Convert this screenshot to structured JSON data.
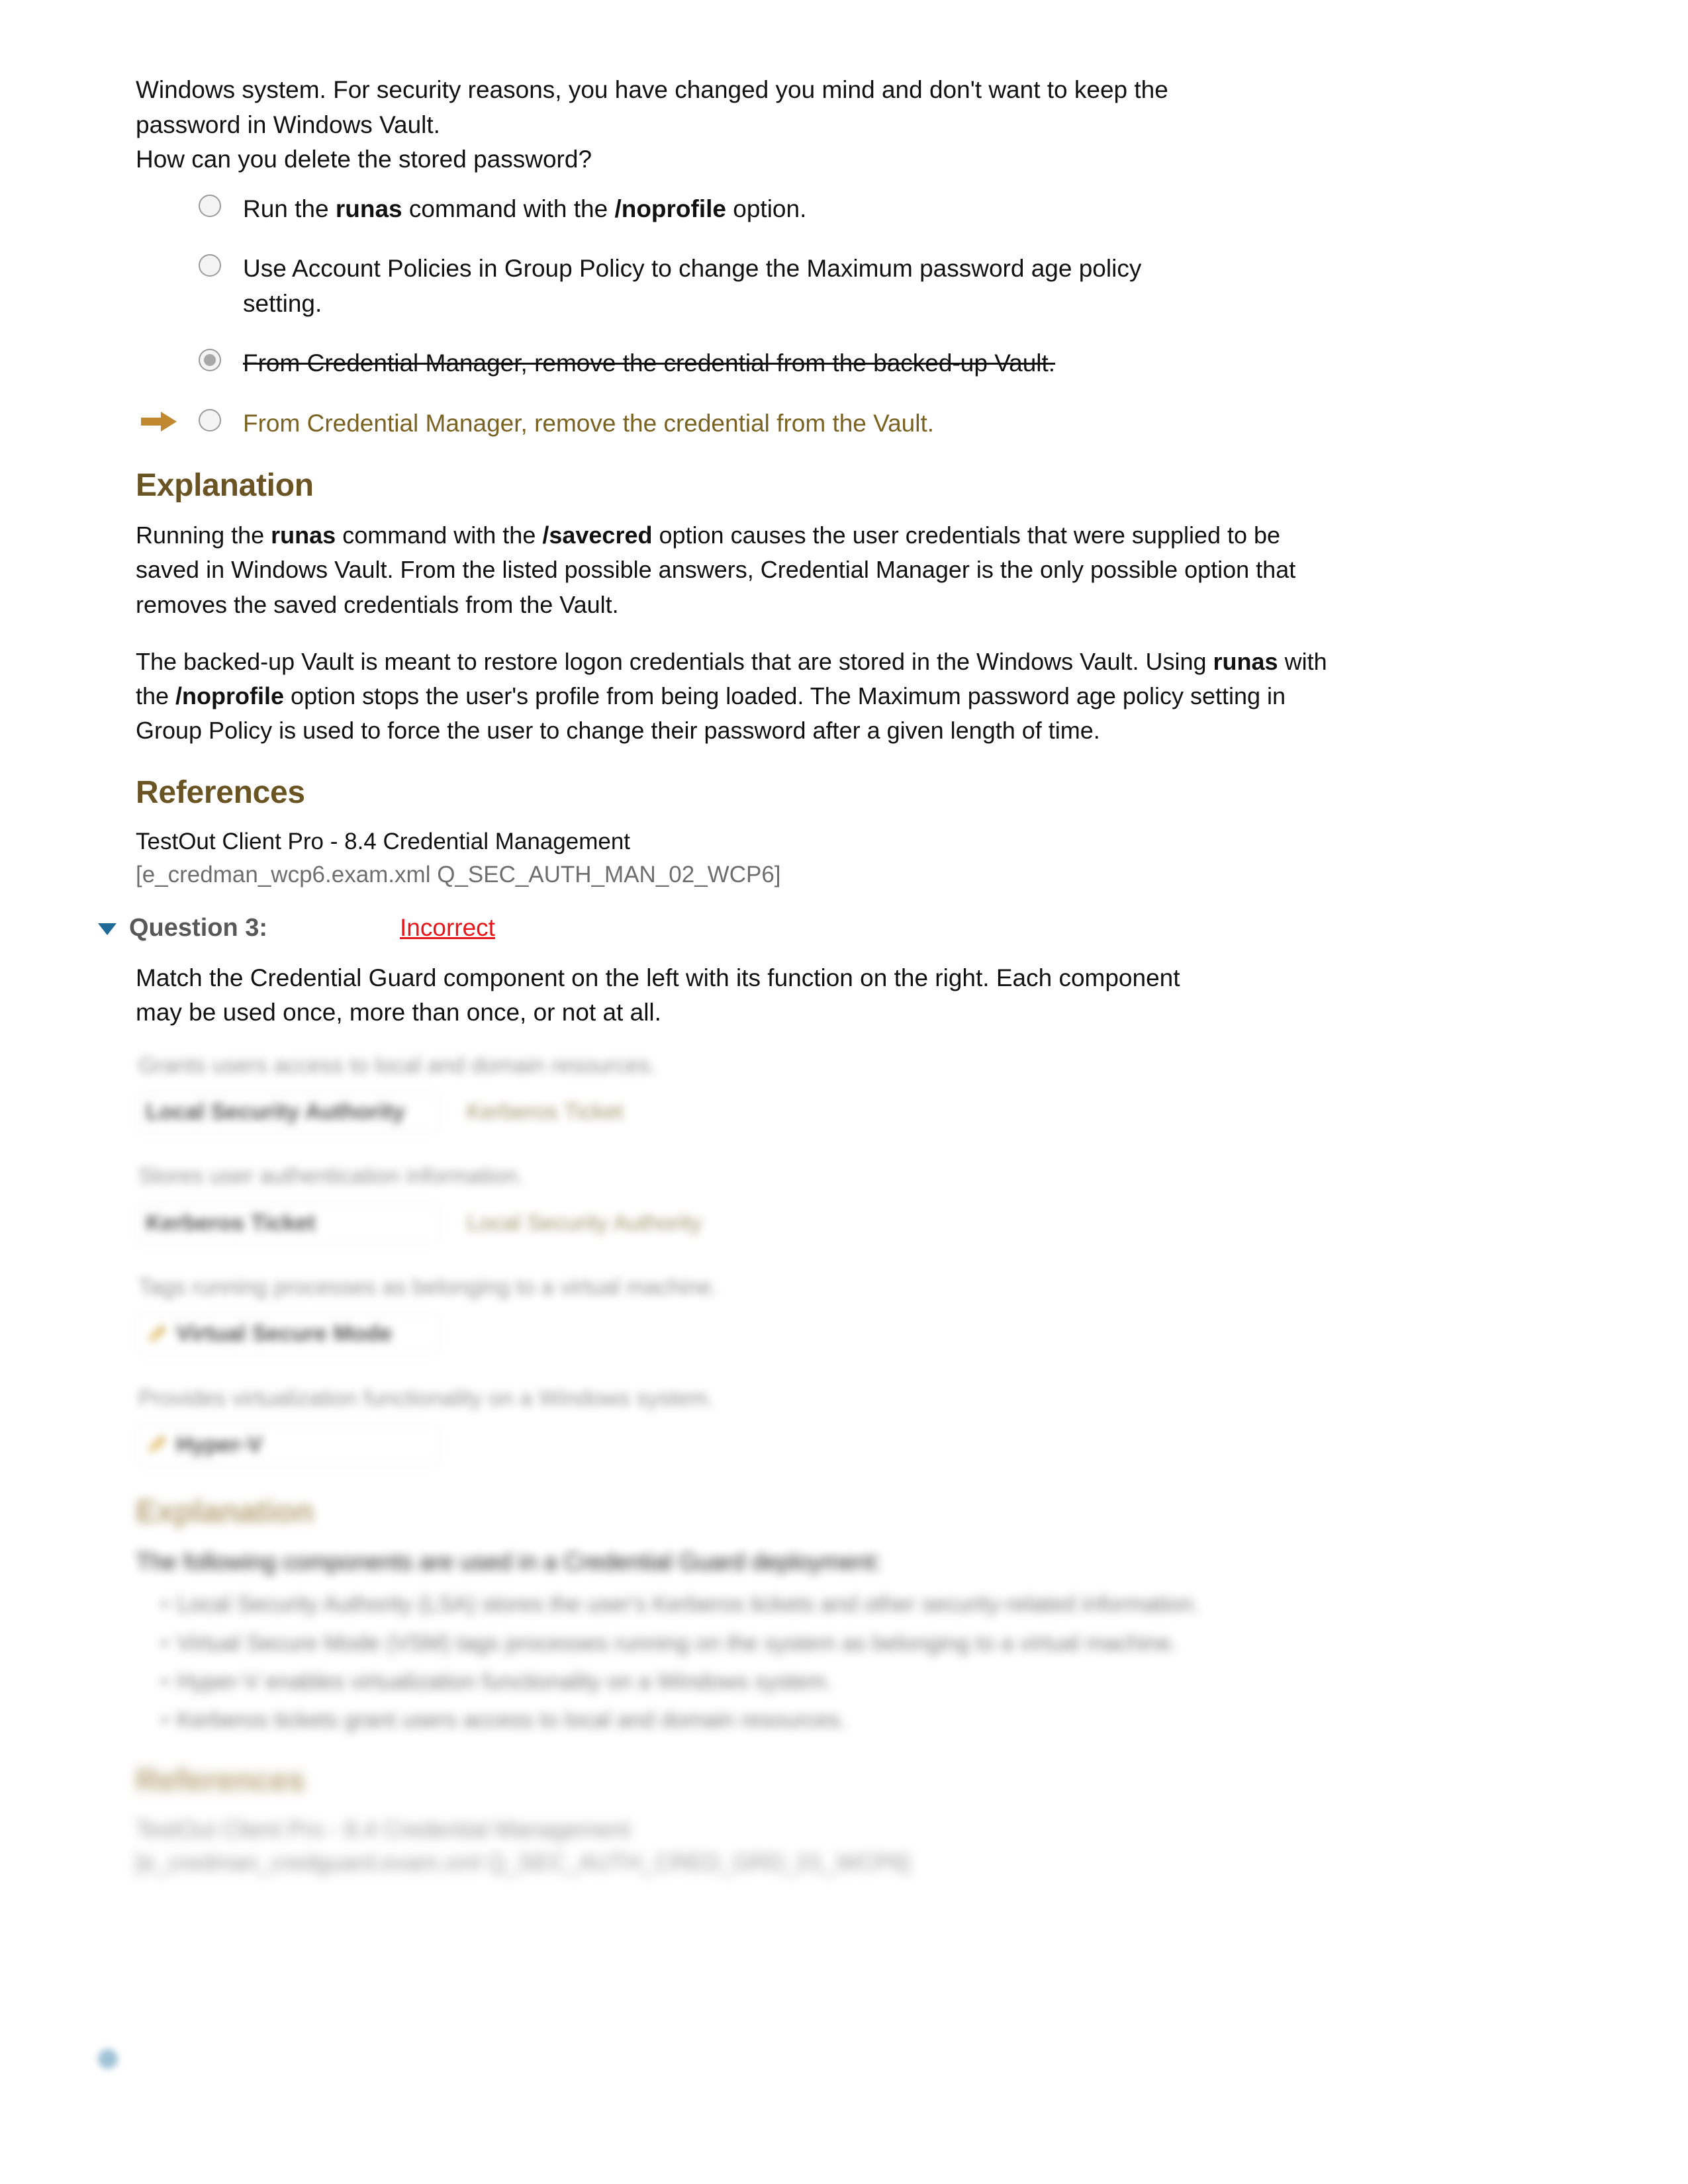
{
  "question2": {
    "stem": {
      "line1": "Windows system. For security reasons, you have changed you mind and don't want to keep the",
      "line2": "password in Windows Vault.",
      "line3": "How can you delete the stored password?"
    },
    "options": [
      {
        "id": "opt-a",
        "text_before": "Run the ",
        "bold1": "runas",
        "text_middle": " command with the ",
        "bold2": "/noprofile",
        "text_after": " option.",
        "plain": "Run the runas command with the /noprofile option.",
        "selected": false,
        "struck": false,
        "highlighted": false,
        "marker": ""
      },
      {
        "id": "opt-b",
        "plain": "Use Account Policies in Group Policy to change the Maximum password age policy setting.",
        "selected": false,
        "struck": false,
        "highlighted": false,
        "marker": ""
      },
      {
        "id": "opt-c",
        "plain": "From Credential Manager, remove the credential from the backed-up Vault.",
        "selected": true,
        "struck": true,
        "highlighted": false,
        "marker": ""
      },
      {
        "id": "opt-d",
        "plain": "From Credential Manager, remove the credential from the Vault.",
        "selected": false,
        "struck": false,
        "highlighted": true,
        "marker": "right-arrow-icon"
      }
    ],
    "explanation": {
      "heading": "Explanation",
      "p1_a": "Running the ",
      "p1_b1": "runas",
      "p1_b": " command with the ",
      "p1_b2": "/savecred",
      "p1_c": " option causes the user credentials that were supplied to be saved in Windows Vault. From the listed possible answers, Credential Manager is the only possible option that removes the saved credentials from the Vault.",
      "p2_a": "The backed-up Vault is meant to restore logon credentials that are stored in the Windows Vault. Using ",
      "p2_b1": "runas",
      "p2_b": " with the ",
      "p2_b2": "/noprofile",
      "p2_c": " option stops the user's profile from being loaded. The Maximum password age policy setting in Group Policy is used to force the user to change their password after a given length of time."
    },
    "references": {
      "heading": "References",
      "title": "TestOut Client Pro - 8.4 Credential Management",
      "id": "[e_credman_wcp6.exam.xml Q_SEC_AUTH_MAN_02_WCP6]"
    }
  },
  "question3": {
    "label": "Question 3:",
    "status": "Incorrect",
    "status_color": "#e8161a",
    "collapse_icon": "triangle-down-icon",
    "collapse_icon_color": "#1f6b96",
    "prompt_line1": "Match the Credential Guard component on the left with its function on the right. Each component",
    "prompt_line2": "may be used once, more than once, or not at all.",
    "matches": [
      {
        "description": "Grants users access to local and domain resources.",
        "left_label": "Local Security Authority",
        "left_icon": "",
        "right_answer": "Kerberos Ticket"
      },
      {
        "description": "Stores user authentication information.",
        "left_label": "Kerberos Ticket",
        "left_icon": "",
        "right_answer": "Local Security Authority"
      },
      {
        "description": "Tags running processes as belonging to a virtual machine.",
        "left_label": "Virtual Secure Mode",
        "left_icon": "pencil-icon",
        "right_answer": ""
      },
      {
        "description": "Provides virtualization functionality on a Windows system.",
        "left_label": "Hyper-V",
        "left_icon": "pencil-icon",
        "right_answer": ""
      }
    ],
    "explanation": {
      "heading": "Explanation",
      "intro": "The following components are used in a Credential Guard deployment:",
      "bullets": [
        "Local Security Authority (LSA) stores the user's Kerberos tickets and other security-related information.",
        "Virtual Secure Mode (VSM) tags processes running on the system as belonging to a virtual machine.",
        "Hyper-V enables virtualization functionality on a Windows system.",
        "Kerberos tickets grant users access to local and domain resources."
      ]
    },
    "references": {
      "heading": "References",
      "title": "TestOut Client Pro - 8.4 Credential Management",
      "id": "[e_credman_credguard.exam.xml Q_SEC_AUTH_CRED_GRD_01_WCP6]"
    }
  }
}
